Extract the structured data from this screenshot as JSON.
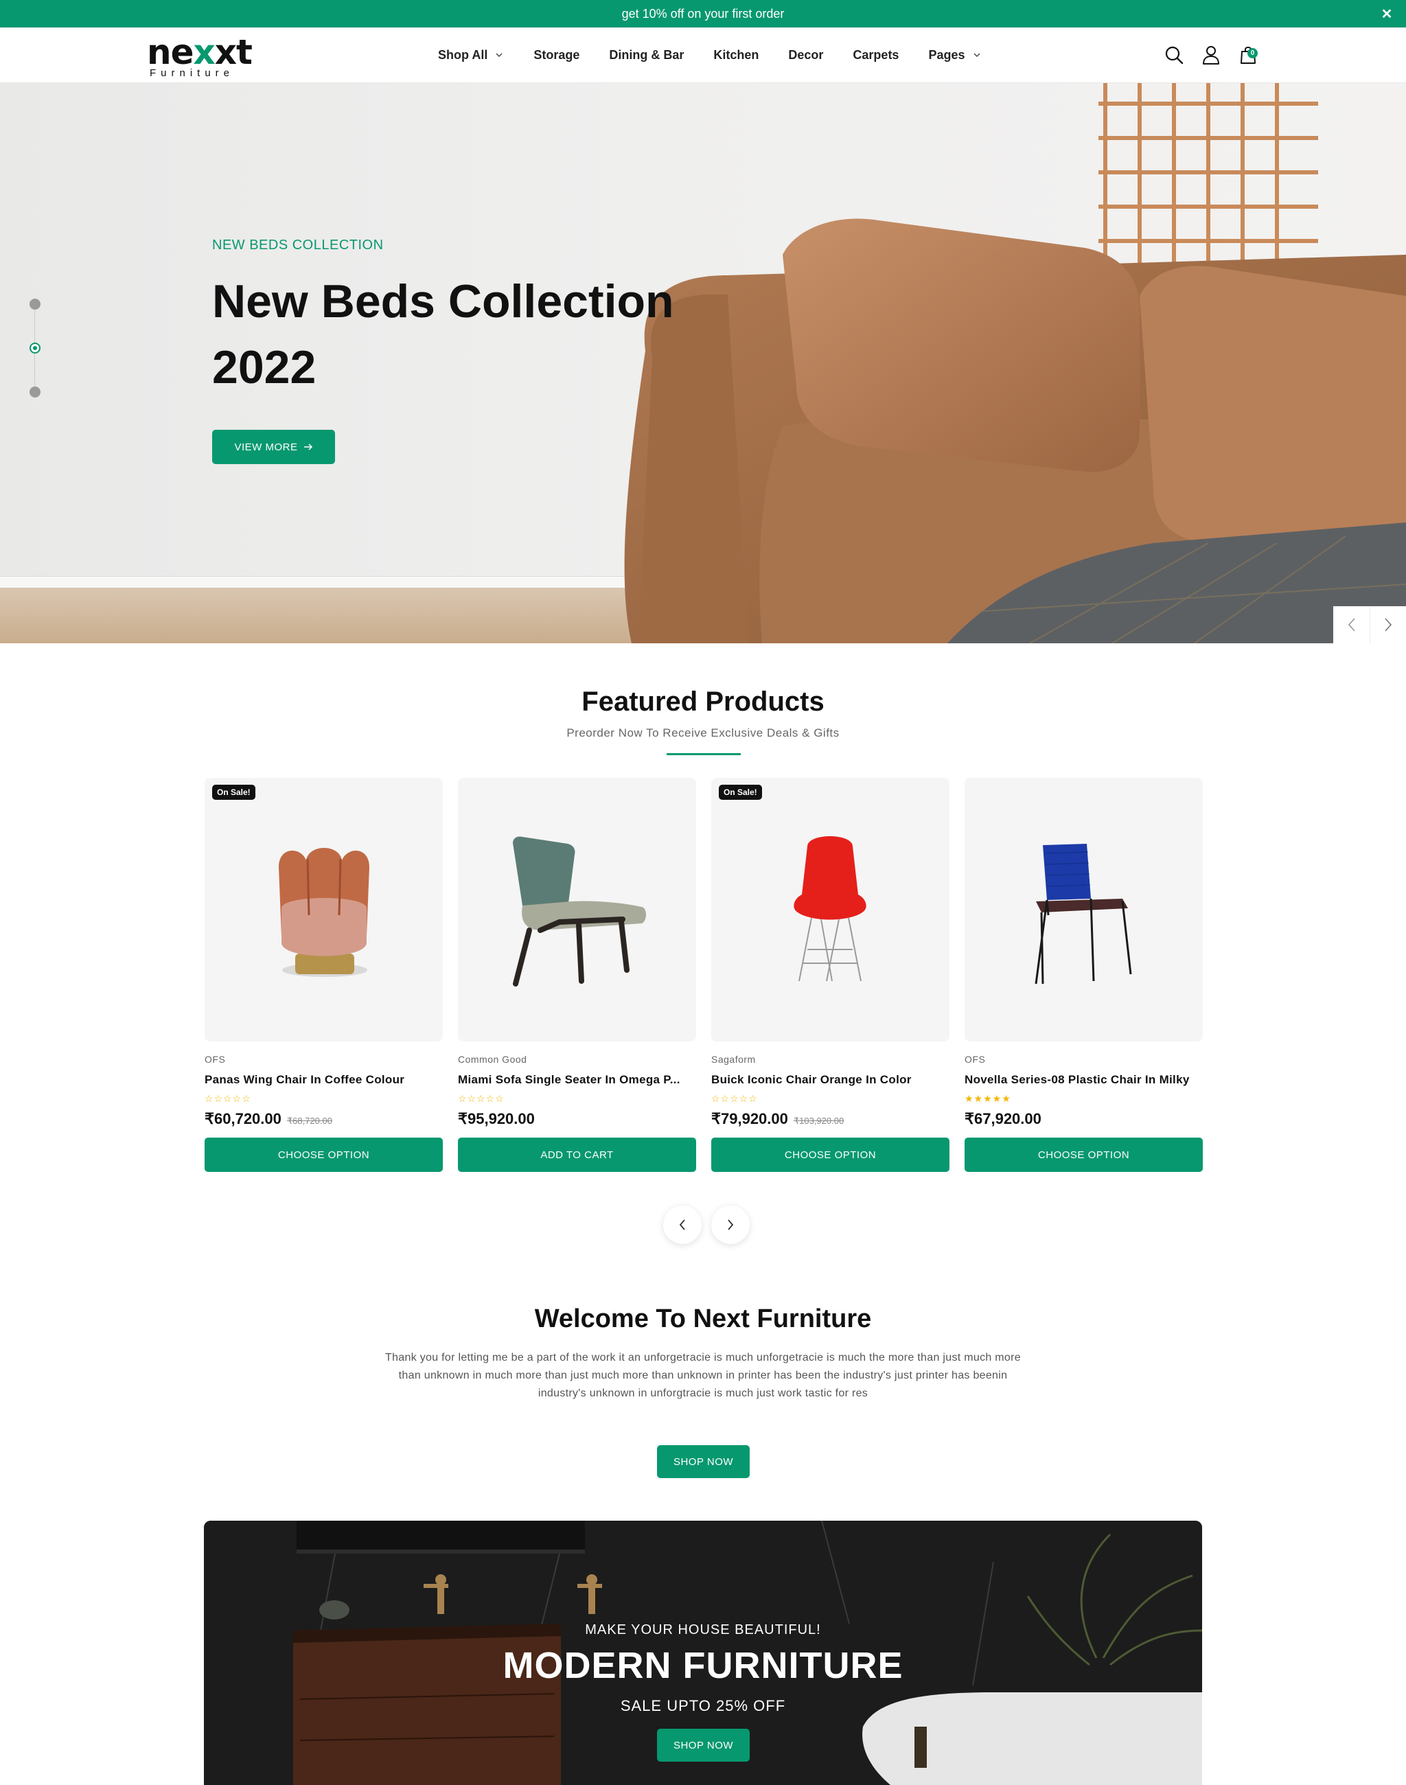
{
  "announcement": {
    "text": "get 10% off on your first order"
  },
  "header": {
    "logo_main_a": "ne",
    "logo_main_accent": "x",
    "logo_main_b": "xt",
    "logo_sub": "Furniture",
    "nav": [
      {
        "label": "Shop All",
        "has_dropdown": true
      },
      {
        "label": "Storage",
        "has_dropdown": false
      },
      {
        "label": "Dining & Bar",
        "has_dropdown": false
      },
      {
        "label": "Kitchen",
        "has_dropdown": false
      },
      {
        "label": "Decor",
        "has_dropdown": false
      },
      {
        "label": "Carpets",
        "has_dropdown": false
      },
      {
        "label": "Pages",
        "has_dropdown": true
      }
    ],
    "icons": [
      "search-icon",
      "user-icon",
      "shopping-bag-icon"
    ],
    "cart_count": "0"
  },
  "hero": {
    "subtitle": "NEW BEDS COLLECTION",
    "title": "New Beds Collection 2022",
    "button_label": "VIEW MORE",
    "slides_total": 3,
    "active_slide": 2
  },
  "featured": {
    "title": "Featured Products",
    "subtitle": "Preorder Now To Receive Exclusive Deals & Gifts",
    "products": [
      {
        "vendor": "OFS",
        "name": "Panas Wing Chair In Coffee Colour",
        "rating": 0,
        "price": "₹60,720.00",
        "compare_price": "₹68,720.00",
        "badge": "On Sale!",
        "button": "CHOOSE OPTION"
      },
      {
        "vendor": "Common Good",
        "name": "Miami Sofa Single Seater In Omega P...",
        "rating": 0,
        "price": "₹95,920.00",
        "compare_price": "",
        "badge": "",
        "button": "ADD TO CART"
      },
      {
        "vendor": "Sagaform",
        "name": "Buick Iconic Chair Orange In Color",
        "rating": 0,
        "price": "₹79,920.00",
        "compare_price": "₹103,920.00",
        "badge": "On Sale!",
        "button": "CHOOSE OPTION"
      },
      {
        "vendor": "OFS",
        "name": "Novella Series-08 Plastic Chair In Milky",
        "rating": 5,
        "price": "₹67,920.00",
        "compare_price": "",
        "badge": "",
        "button": "CHOOSE OPTION"
      }
    ]
  },
  "welcome": {
    "title": "Welcome To Next Furniture",
    "body": "Thank you for letting me be a part of the work it an unforgetracie is much unforgetracie is much the more than just much more than unknown in much more than just much more than unknown in printer has been the industry's just printer has beenin industry's unknown in unforgtracie is much just work tastic for res",
    "button_label": "SHOP NOW"
  },
  "banner": {
    "kicker": "MAKE YOUR HOUSE BEAUTIFUL!",
    "title": "MODERN FURNITURE",
    "subtitle": "SALE UPTO 25% OFF",
    "button_label": "SHOP NOW"
  },
  "colors": {
    "accent": "#07986f",
    "text": "#111111",
    "star": "#f2b705"
  }
}
